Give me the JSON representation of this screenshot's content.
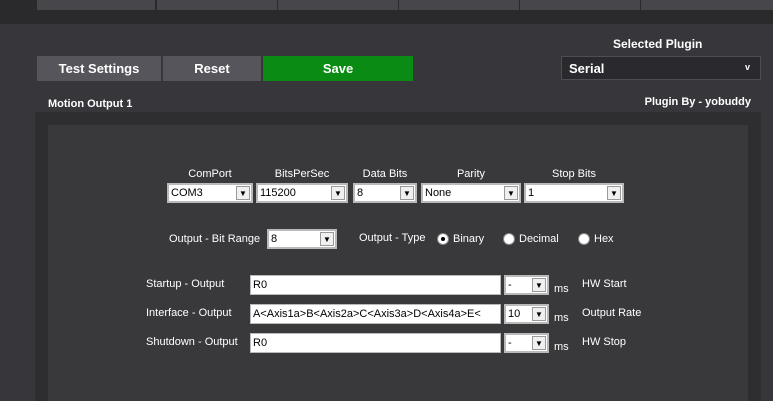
{
  "toolbar": {
    "test_label": "Test Settings",
    "reset_label": "Reset",
    "save_label": "Save",
    "save_color": "#0a8c14"
  },
  "plugin": {
    "selected_label": "Selected Plugin",
    "selected_value": "Serial",
    "by": "Plugin By - yobuddy"
  },
  "section": {
    "title": "Motion Output 1"
  },
  "serial": {
    "comport": {
      "label": "ComPort",
      "value": "COM3"
    },
    "bits_per_sec": {
      "label": "BitsPerSec",
      "value": "115200"
    },
    "data_bits": {
      "label": "Data Bits",
      "value": "8"
    },
    "parity": {
      "label": "Parity",
      "value": "None"
    },
    "stop_bits": {
      "label": "Stop Bits",
      "value": "1"
    }
  },
  "output": {
    "bit_range_label": "Output - Bit Range",
    "bit_range_value": "8",
    "type_label": "Output - Type",
    "types": [
      "Binary",
      "Decimal",
      "Hex"
    ],
    "selected_type": "Binary"
  },
  "rows": {
    "startup": {
      "label": "Startup - Output",
      "value": "R0",
      "ms_value": "-",
      "unit": "ms",
      "right_label": "HW Start"
    },
    "interface": {
      "label": "Interface - Output",
      "value": "A<Axis1a>B<Axis2a>C<Axis3a>D<Axis4a>E<",
      "ms_value": "10",
      "unit": "ms",
      "right_label": "Output Rate"
    },
    "shutdown": {
      "label": "Shutdown - Output",
      "value": "R0",
      "ms_value": "-",
      "unit": "ms",
      "right_label": "HW Stop"
    }
  }
}
